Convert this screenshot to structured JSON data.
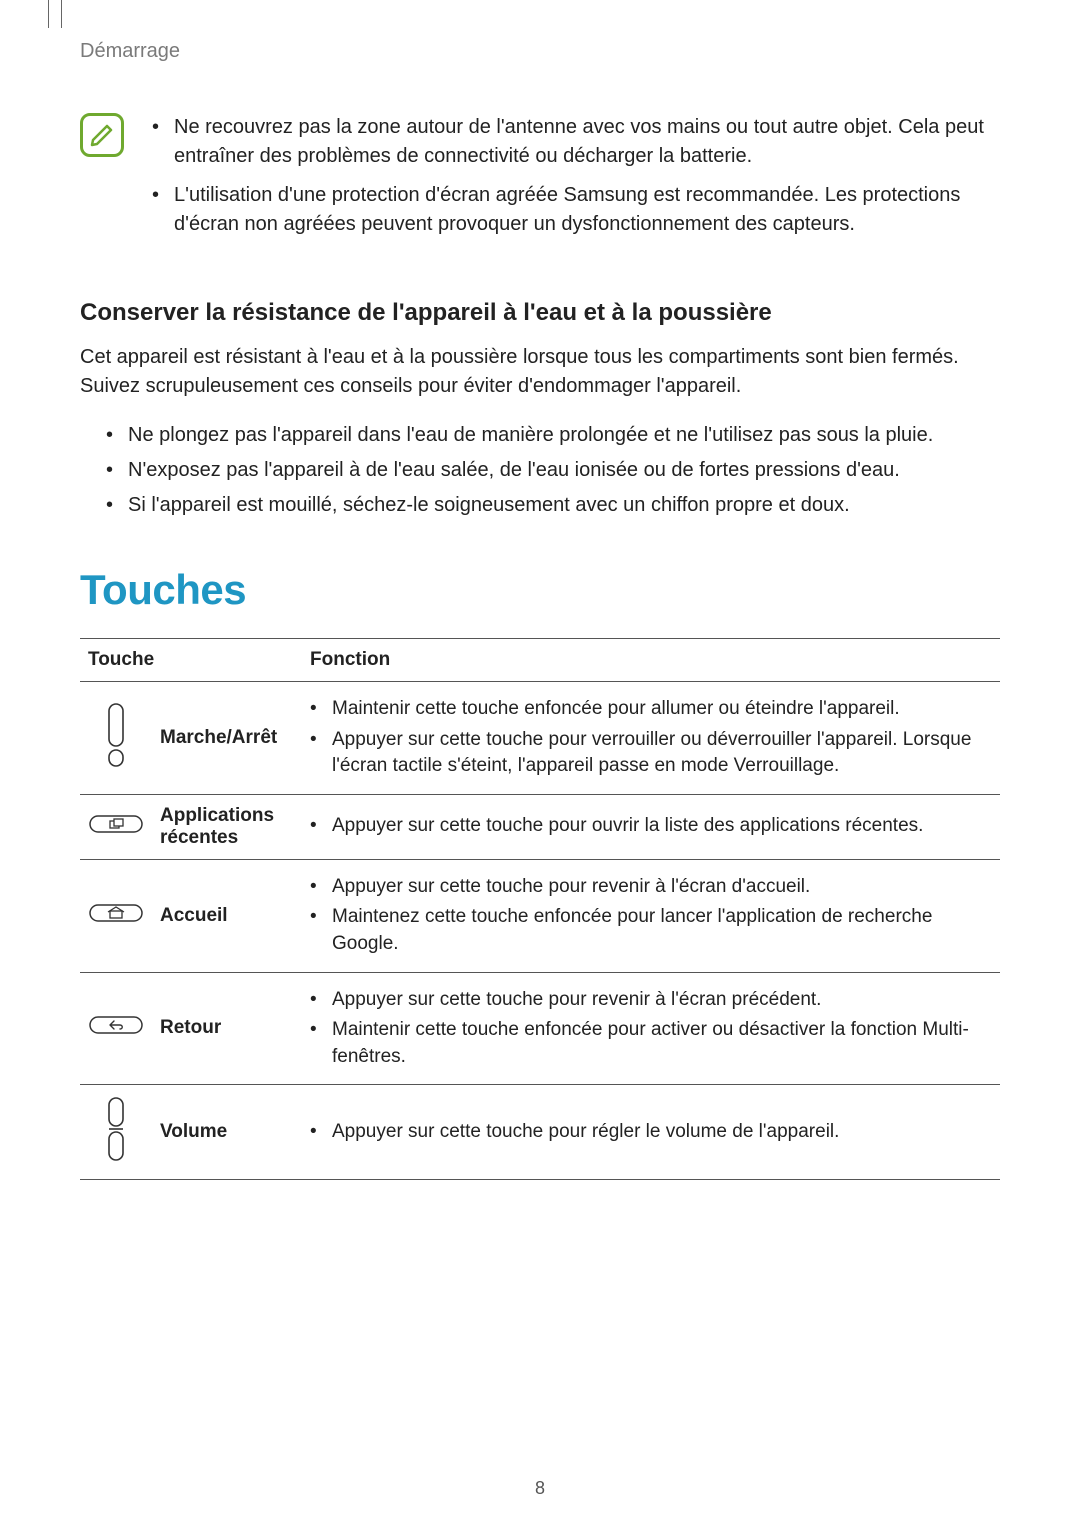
{
  "breadcrumb": "Démarrage",
  "note_bullets": [
    "Ne recouvrez pas la zone autour de l'antenne avec vos mains ou tout autre objet. Cela peut entraîner des problèmes de connectivité ou décharger la batterie.",
    "L'utilisation d'une protection d'écran agréée Samsung est recommandée. Les protections d'écran non agréées peuvent provoquer un dysfonctionnement des capteurs."
  ],
  "subheading": "Conserver la résistance de l'appareil à l'eau et à la poussière",
  "intro_text": "Cet appareil est résistant à l'eau et à la poussière lorsque tous les compartiments sont bien fermés. Suivez scrupuleusement ces conseils pour éviter d'endommager l'appareil.",
  "tips": [
    "Ne plongez pas l'appareil dans l'eau de manière prolongée et ne l'utilisez pas sous la pluie.",
    "N'exposez pas l'appareil à de l'eau salée, de l'eau ionisée ou de fortes pressions d'eau.",
    "Si l'appareil est mouillé, séchez-le soigneusement avec un chiffon propre et doux."
  ],
  "section_title": "Touches",
  "table": {
    "headers": {
      "key": "Touche",
      "fn": "Fonction"
    },
    "rows": [
      {
        "icon": "power",
        "label": "Marche/Arrêt",
        "fns": [
          "Maintenir cette touche enfoncée pour allumer ou éteindre l'appareil.",
          "Appuyer sur cette touche pour verrouiller ou déverrouiller l'appareil. Lorsque l'écran tactile s'éteint, l'appareil passe en mode Verrouillage."
        ]
      },
      {
        "icon": "recent",
        "label": "Applications récentes",
        "fns": [
          "Appuyer sur cette touche pour ouvrir la liste des applications récentes."
        ]
      },
      {
        "icon": "home",
        "label": "Accueil",
        "fns": [
          "Appuyer sur cette touche pour revenir à l'écran d'accueil.",
          "Maintenez cette touche enfoncée pour lancer l'application de recherche Google."
        ]
      },
      {
        "icon": "back",
        "label": "Retour",
        "fns": [
          "Appuyer sur cette touche pour revenir à l'écran précédent.",
          "Maintenir cette touche enfoncée pour activer ou désactiver la fonction Multi-fenêtres."
        ]
      },
      {
        "icon": "volume",
        "label": "Volume",
        "fns": [
          "Appuyer sur cette touche pour régler le volume de l'appareil."
        ]
      }
    ]
  },
  "page_number": "8"
}
